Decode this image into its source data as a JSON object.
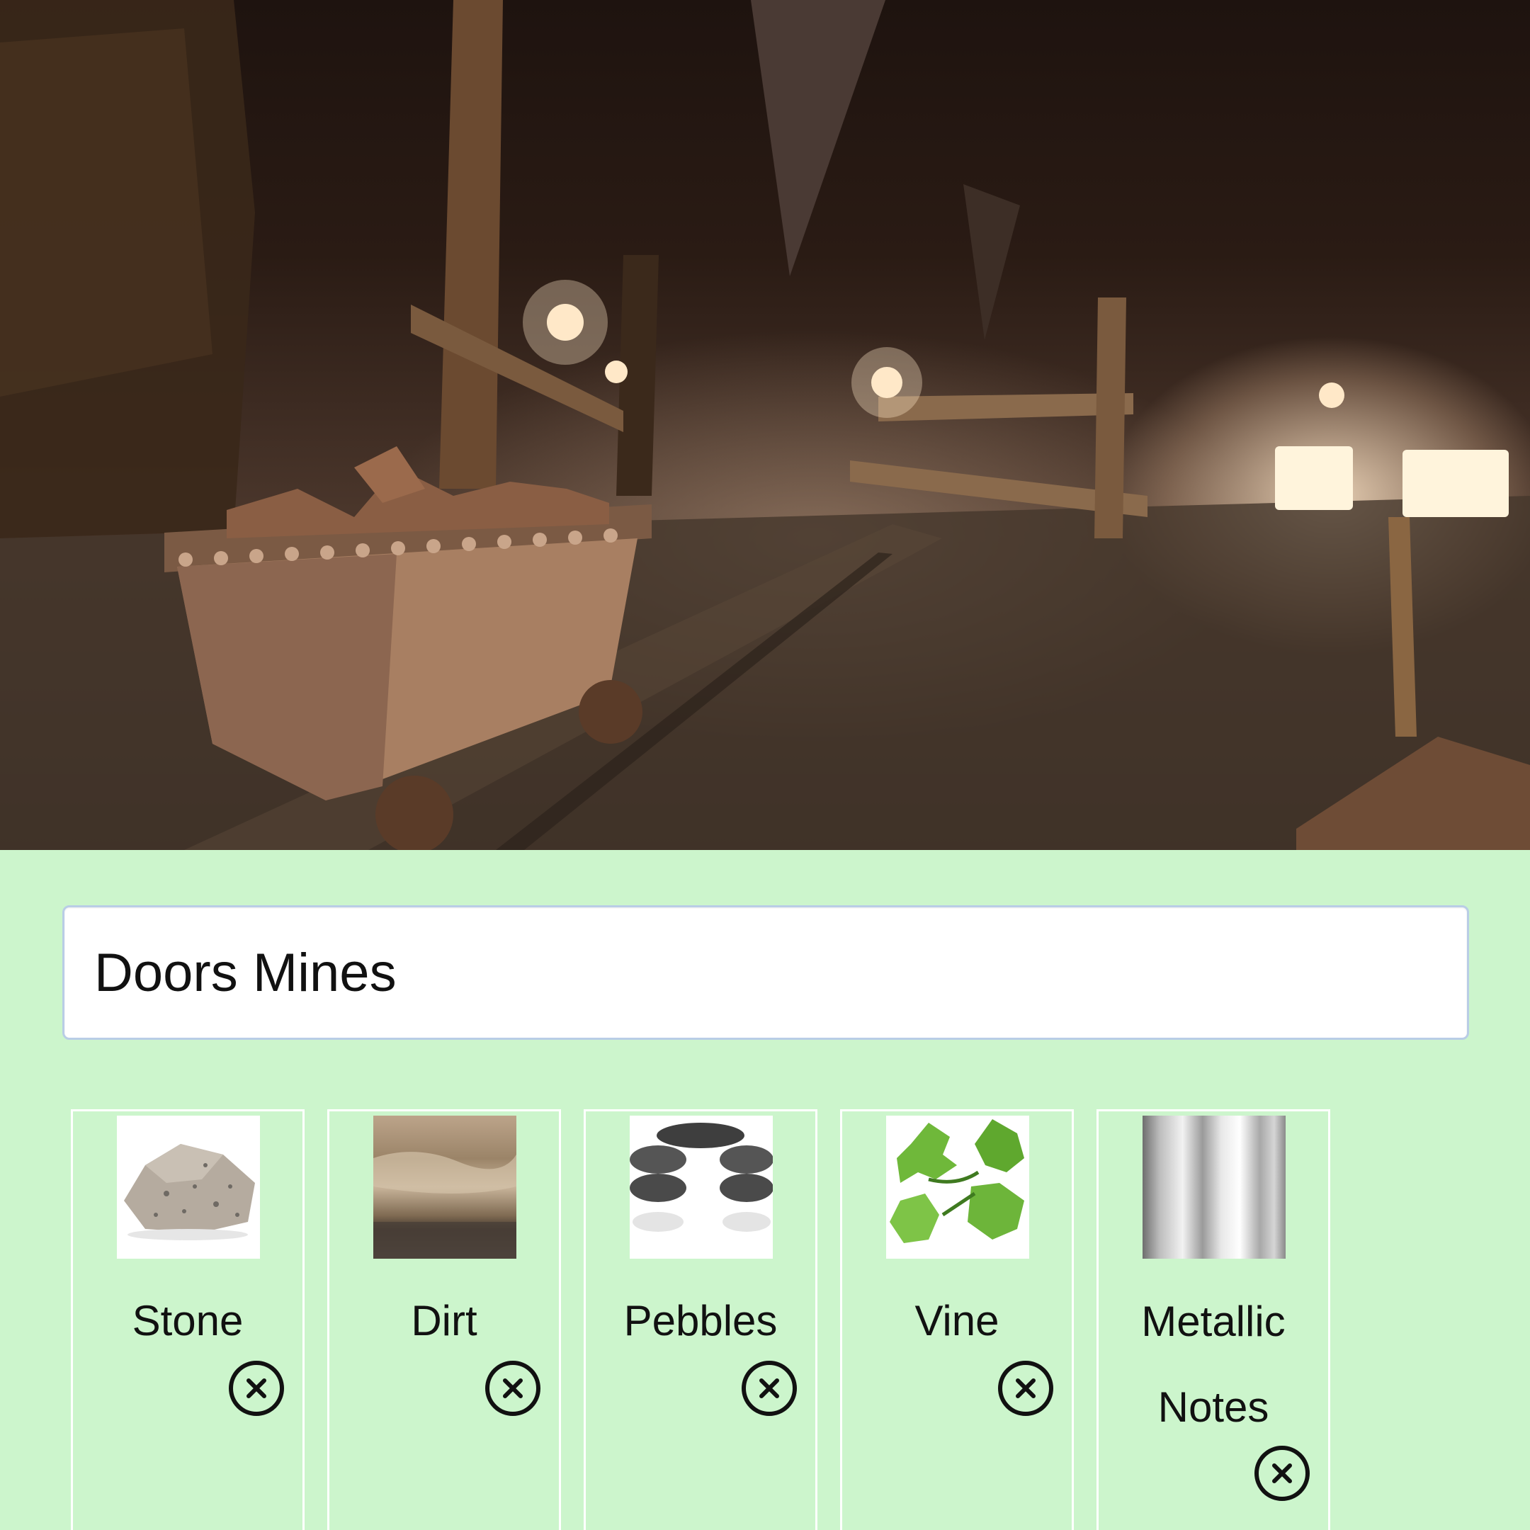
{
  "scene": {
    "description_icon": "mine-scene-image"
  },
  "project": {
    "title_value": "Doors Mines"
  },
  "materials": [
    {
      "label": "Stone",
      "icon": "stone-texture"
    },
    {
      "label": "Dirt",
      "icon": "dirt-texture"
    },
    {
      "label": "Pebbles",
      "icon": "pebbles-texture"
    },
    {
      "label": "Vine",
      "icon": "vine-texture"
    },
    {
      "label": "Metallic Notes",
      "icon": "metallic-texture"
    }
  ],
  "icons": {
    "remove": "close-circle-icon"
  },
  "colors": {
    "panel_background": "#ccf5cc",
    "card_border": "#ffffff",
    "input_border": "#b9cde6"
  }
}
